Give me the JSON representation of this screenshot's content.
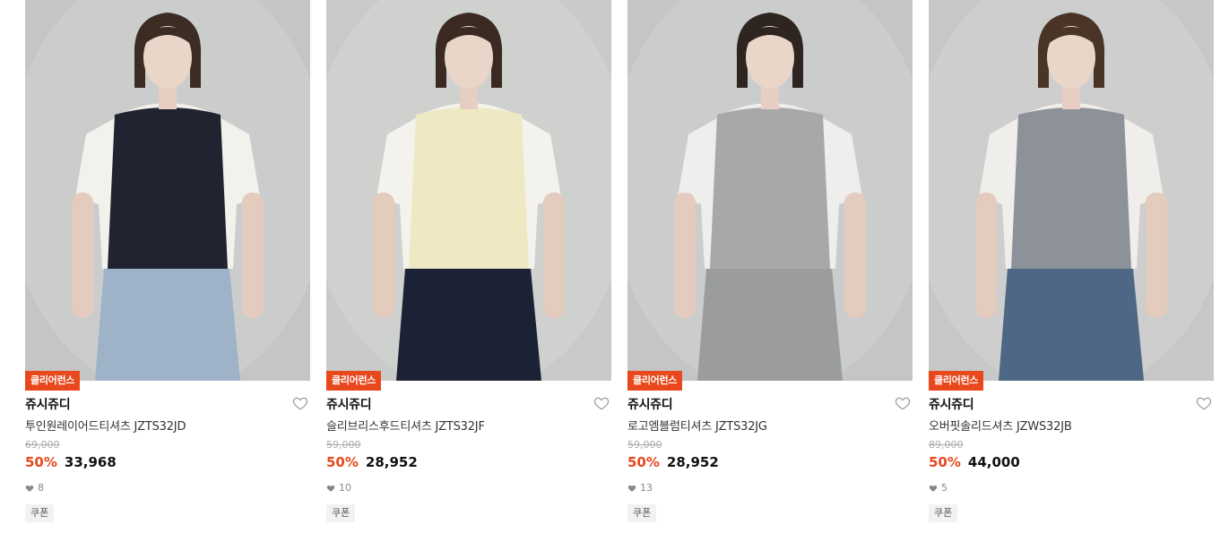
{
  "products": [
    {
      "badge": "클리어런스",
      "brand": "쥬시쥬디",
      "name": "투인원레이어드티셔츠 JZTS32JD",
      "original_price": "69,000",
      "discount": "50%",
      "price": "33,968",
      "likes": "8",
      "coupon": "쿠폰",
      "photo": {
        "bg": "#c4c6c5",
        "top": "#1f2430",
        "inner": "#f3f1ec",
        "bottom": "#9fb3c8",
        "hair": "#3b2c24"
      }
    },
    {
      "badge": "클리어런스",
      "brand": "쥬시쥬디",
      "name": "슬리브리스후드티셔츠 JZTS32JF",
      "original_price": "59,000",
      "discount": "50%",
      "price": "28,952",
      "likes": "10",
      "coupon": "쿠폰",
      "photo": {
        "bg": "#c9cbc9",
        "top": "#efe9c3",
        "inner": "#f4f2ec",
        "bottom": "#1c2236",
        "hair": "#3a2a22"
      }
    },
    {
      "badge": "클리어런스",
      "brand": "쥬시쥬디",
      "name": "로고엠블럼티셔츠 JZTS32JG",
      "original_price": "59,000",
      "discount": "50%",
      "price": "28,952",
      "likes": "13",
      "coupon": "쿠폰",
      "photo": {
        "bg": "#c3c6c4",
        "top": "#a6a8aa",
        "inner": "#eeeeec",
        "bottom": "#9a9c9e",
        "hair": "#2e2420"
      }
    },
    {
      "badge": "클리어런스",
      "brand": "쥬시쥬디",
      "name": "오버핏솔리드셔츠 JZWS32JB",
      "original_price": "89,000",
      "discount": "50%",
      "price": "44,000",
      "likes": "5",
      "coupon": "쿠폰",
      "photo": {
        "bg": "#c6c8c7",
        "top": "#8d929a",
        "inner": "#f0eeea",
        "bottom": "#4d6784",
        "hair": "#4a3428"
      }
    }
  ],
  "colors": {
    "accent": "#e8481c",
    "text": "#111111",
    "muted": "#888888"
  },
  "icons": {
    "wishlist": "heart-outline-icon",
    "likes": "heart-filled-icon"
  }
}
